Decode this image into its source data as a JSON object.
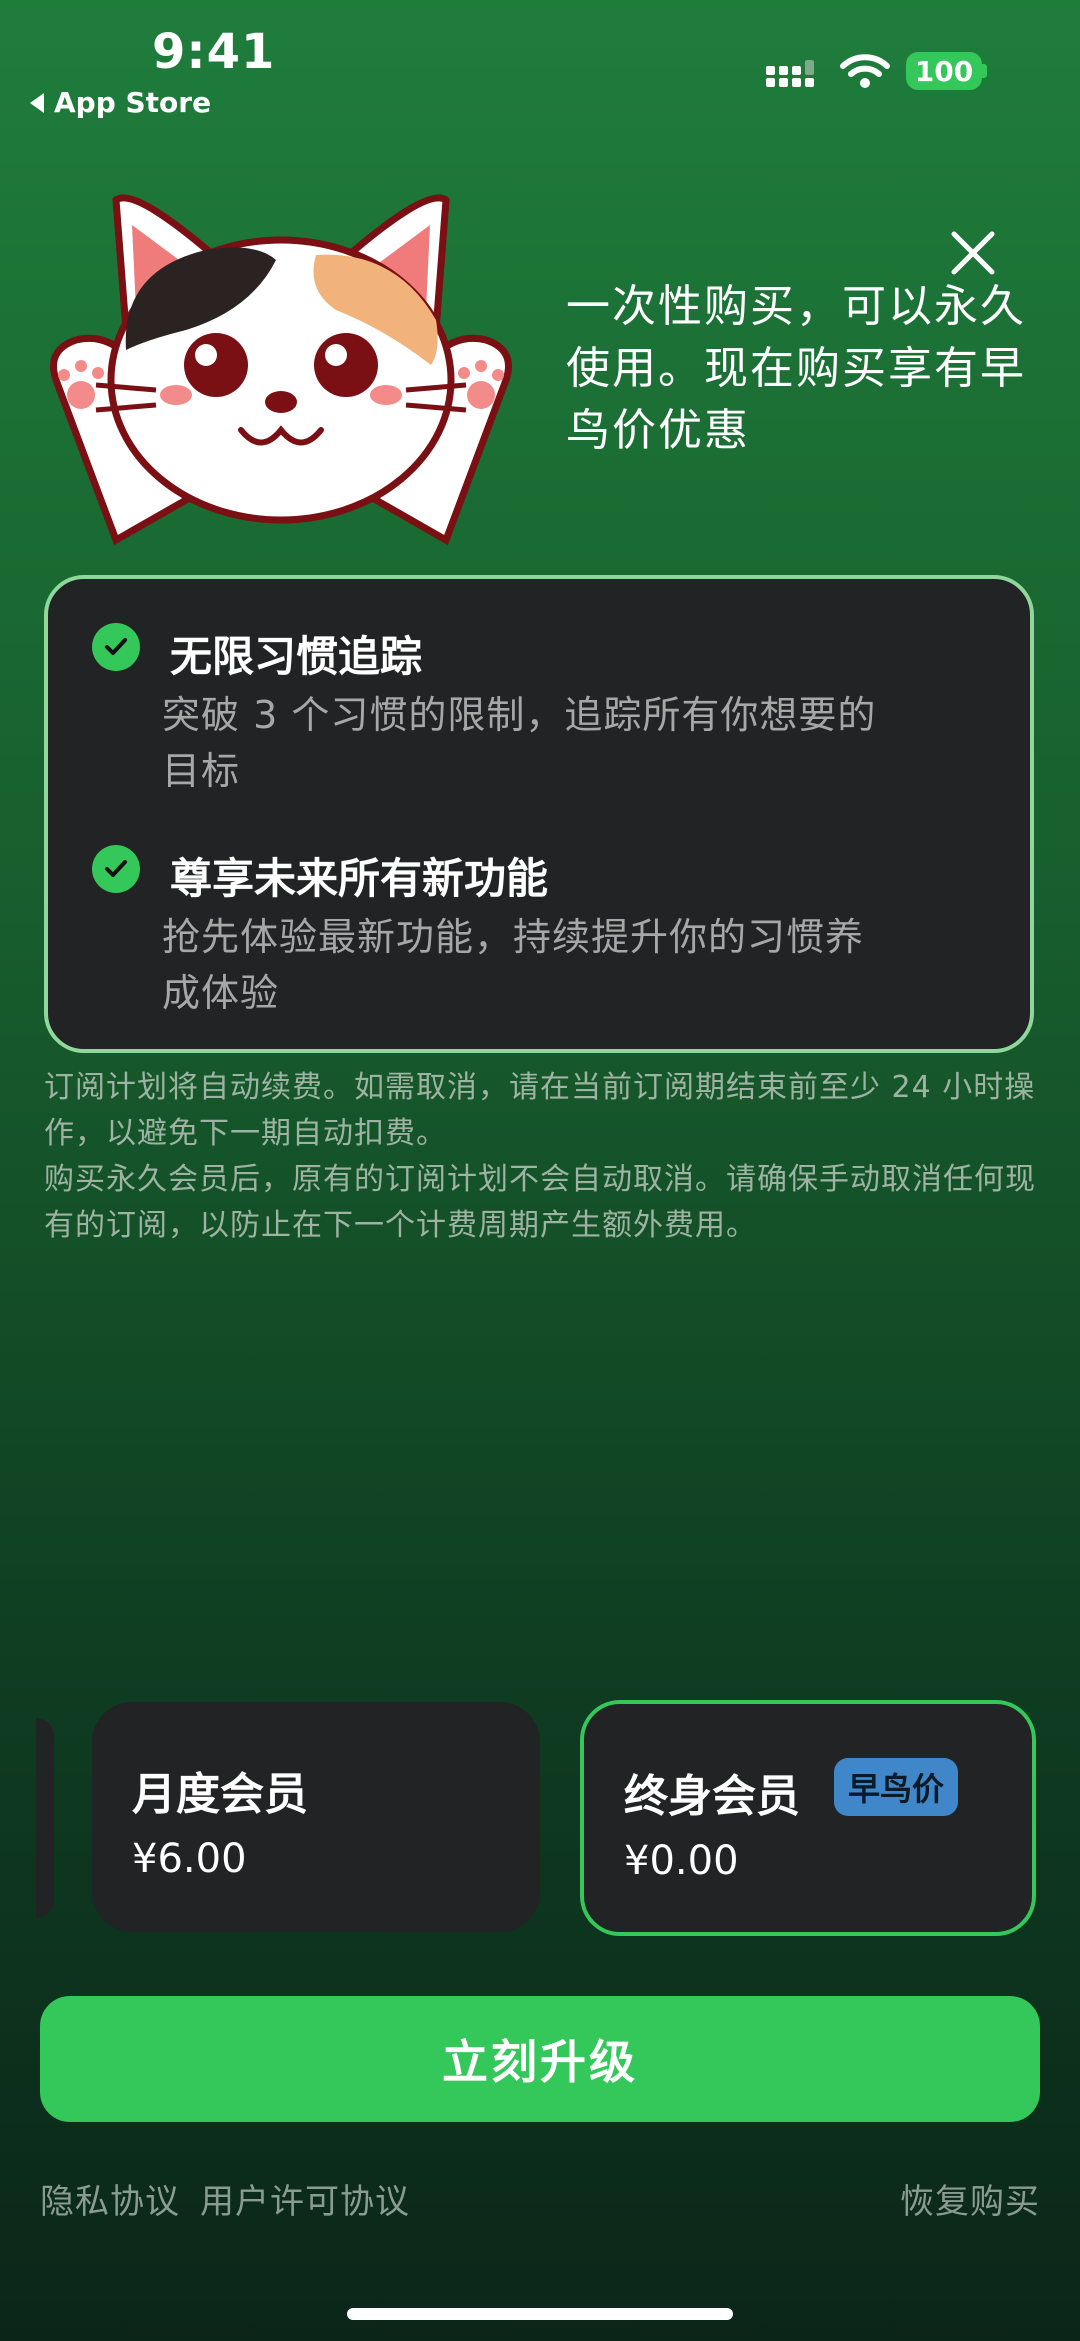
{
  "status_bar": {
    "time": "9:41",
    "back_label": "App Store",
    "battery": "100"
  },
  "promo": {
    "tagline": "一次性购买，可以永久使用。现在购买享有早鸟价优惠"
  },
  "features": [
    {
      "title": "无限习惯追踪",
      "description": "突破 3 个习惯的限制，追踪所有你想要的目标"
    },
    {
      "title": "尊享未来所有新功能",
      "description": "抢先体验最新功能，持续提升你的习惯养成体验"
    }
  ],
  "notes": [
    "订阅计划将自动续费。如需取消，请在当前订阅期结束前至少 24 小时操作，以避免下一期自动扣费。",
    "购买永久会员后，原有的订阅计划不会自动取消。请确保手动取消任何现有的订阅，以防止在下一个计费周期产生额外费用。"
  ],
  "plans": [
    {
      "name": "月度会员",
      "price": "¥6.00"
    },
    {
      "name": "终身会员",
      "price": "¥0.00",
      "badge": "早鸟价",
      "selected": true
    }
  ],
  "cta_label": "立刻升级",
  "footer": {
    "privacy": "隐私协议",
    "license": "用户许可协议",
    "restore": "恢复购买"
  },
  "colors": {
    "accent": "#34c759",
    "card": "#222324",
    "badge": "#3f87c8",
    "features_border": "#8fd79a"
  },
  "icons": [
    "back-arrow-icon",
    "signal-icon",
    "wifi-icon",
    "battery-icon",
    "close-icon",
    "check-icon",
    "cat-mascot"
  ]
}
